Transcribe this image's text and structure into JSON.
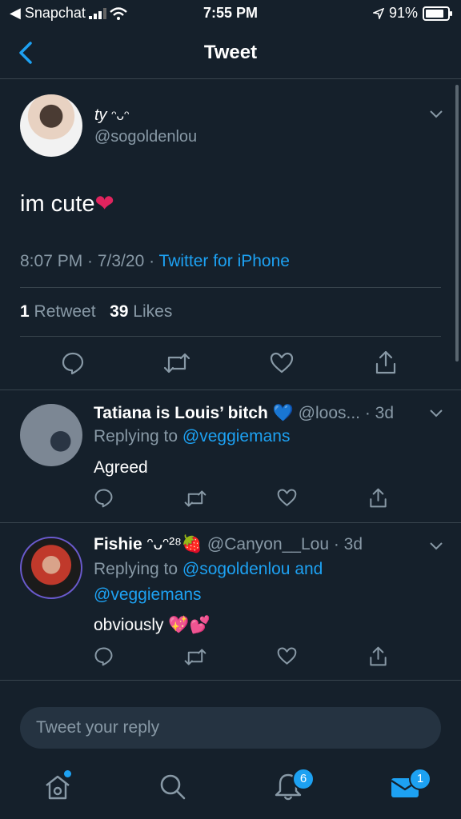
{
  "status_bar": {
    "back_app": "◀ Snapchat",
    "time": "7:55 PM",
    "battery": "91%",
    "battery_level": 0.91
  },
  "nav": {
    "title": "Tweet"
  },
  "tweet": {
    "display_name": "ty",
    "name_emoji": "ᵔᴗᵔ",
    "handle": "@sogoldenlou",
    "text": "im cute",
    "text_emoji": "❤",
    "time": "8:07 PM · 7/3/20 · ",
    "source": "Twitter for iPhone",
    "retweet_count": "1",
    "retweet_label": "Retweet",
    "like_count": "39",
    "like_label": "Likes"
  },
  "replies": [
    {
      "name": "Tatiana is Louis’ bitch",
      "name_emoji": "💙",
      "handle_time": "@loos... · 3d",
      "replying_prefix": "Replying to ",
      "replying_to": "@veggiemans",
      "replying_to_2": "",
      "text": "Agreed"
    },
    {
      "name": "Fishie",
      "name_emoji": "ᵔᴗᵔ²⁸🍓",
      "handle_time": "@Canyon__Lou · 3d",
      "replying_prefix": "Replying to ",
      "replying_to": "@sogoldenlou and",
      "replying_to_2": "@veggiemans",
      "text": "obviously",
      "text_emoji": "💖💕"
    }
  ],
  "composer": {
    "placeholder": "Tweet your reply"
  },
  "tabbar": {
    "notifications_badge": "6",
    "messages_badge": "1"
  },
  "colors": {
    "background": "#15202b",
    "accent": "#1da1f2",
    "muted": "#8899a6",
    "divider": "#38444d"
  }
}
